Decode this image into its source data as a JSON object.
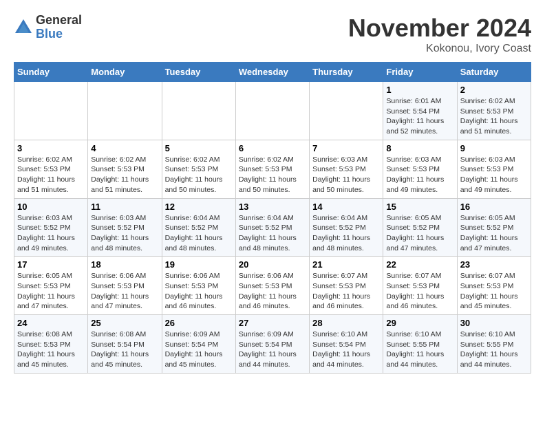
{
  "header": {
    "logo_general": "General",
    "logo_blue": "Blue",
    "month_title": "November 2024",
    "location": "Kokonou, Ivory Coast"
  },
  "days_of_week": [
    "Sunday",
    "Monday",
    "Tuesday",
    "Wednesday",
    "Thursday",
    "Friday",
    "Saturday"
  ],
  "weeks": [
    [
      {
        "day": "",
        "info": ""
      },
      {
        "day": "",
        "info": ""
      },
      {
        "day": "",
        "info": ""
      },
      {
        "day": "",
        "info": ""
      },
      {
        "day": "",
        "info": ""
      },
      {
        "day": "1",
        "info": "Sunrise: 6:01 AM\nSunset: 5:54 PM\nDaylight: 11 hours and 52 minutes."
      },
      {
        "day": "2",
        "info": "Sunrise: 6:02 AM\nSunset: 5:53 PM\nDaylight: 11 hours and 51 minutes."
      }
    ],
    [
      {
        "day": "3",
        "info": "Sunrise: 6:02 AM\nSunset: 5:53 PM\nDaylight: 11 hours and 51 minutes."
      },
      {
        "day": "4",
        "info": "Sunrise: 6:02 AM\nSunset: 5:53 PM\nDaylight: 11 hours and 51 minutes."
      },
      {
        "day": "5",
        "info": "Sunrise: 6:02 AM\nSunset: 5:53 PM\nDaylight: 11 hours and 50 minutes."
      },
      {
        "day": "6",
        "info": "Sunrise: 6:02 AM\nSunset: 5:53 PM\nDaylight: 11 hours and 50 minutes."
      },
      {
        "day": "7",
        "info": "Sunrise: 6:03 AM\nSunset: 5:53 PM\nDaylight: 11 hours and 50 minutes."
      },
      {
        "day": "8",
        "info": "Sunrise: 6:03 AM\nSunset: 5:53 PM\nDaylight: 11 hours and 49 minutes."
      },
      {
        "day": "9",
        "info": "Sunrise: 6:03 AM\nSunset: 5:53 PM\nDaylight: 11 hours and 49 minutes."
      }
    ],
    [
      {
        "day": "10",
        "info": "Sunrise: 6:03 AM\nSunset: 5:52 PM\nDaylight: 11 hours and 49 minutes."
      },
      {
        "day": "11",
        "info": "Sunrise: 6:03 AM\nSunset: 5:52 PM\nDaylight: 11 hours and 48 minutes."
      },
      {
        "day": "12",
        "info": "Sunrise: 6:04 AM\nSunset: 5:52 PM\nDaylight: 11 hours and 48 minutes."
      },
      {
        "day": "13",
        "info": "Sunrise: 6:04 AM\nSunset: 5:52 PM\nDaylight: 11 hours and 48 minutes."
      },
      {
        "day": "14",
        "info": "Sunrise: 6:04 AM\nSunset: 5:52 PM\nDaylight: 11 hours and 48 minutes."
      },
      {
        "day": "15",
        "info": "Sunrise: 6:05 AM\nSunset: 5:52 PM\nDaylight: 11 hours and 47 minutes."
      },
      {
        "day": "16",
        "info": "Sunrise: 6:05 AM\nSunset: 5:52 PM\nDaylight: 11 hours and 47 minutes."
      }
    ],
    [
      {
        "day": "17",
        "info": "Sunrise: 6:05 AM\nSunset: 5:53 PM\nDaylight: 11 hours and 47 minutes."
      },
      {
        "day": "18",
        "info": "Sunrise: 6:06 AM\nSunset: 5:53 PM\nDaylight: 11 hours and 47 minutes."
      },
      {
        "day": "19",
        "info": "Sunrise: 6:06 AM\nSunset: 5:53 PM\nDaylight: 11 hours and 46 minutes."
      },
      {
        "day": "20",
        "info": "Sunrise: 6:06 AM\nSunset: 5:53 PM\nDaylight: 11 hours and 46 minutes."
      },
      {
        "day": "21",
        "info": "Sunrise: 6:07 AM\nSunset: 5:53 PM\nDaylight: 11 hours and 46 minutes."
      },
      {
        "day": "22",
        "info": "Sunrise: 6:07 AM\nSunset: 5:53 PM\nDaylight: 11 hours and 46 minutes."
      },
      {
        "day": "23",
        "info": "Sunrise: 6:07 AM\nSunset: 5:53 PM\nDaylight: 11 hours and 45 minutes."
      }
    ],
    [
      {
        "day": "24",
        "info": "Sunrise: 6:08 AM\nSunset: 5:53 PM\nDaylight: 11 hours and 45 minutes."
      },
      {
        "day": "25",
        "info": "Sunrise: 6:08 AM\nSunset: 5:54 PM\nDaylight: 11 hours and 45 minutes."
      },
      {
        "day": "26",
        "info": "Sunrise: 6:09 AM\nSunset: 5:54 PM\nDaylight: 11 hours and 45 minutes."
      },
      {
        "day": "27",
        "info": "Sunrise: 6:09 AM\nSunset: 5:54 PM\nDaylight: 11 hours and 44 minutes."
      },
      {
        "day": "28",
        "info": "Sunrise: 6:10 AM\nSunset: 5:54 PM\nDaylight: 11 hours and 44 minutes."
      },
      {
        "day": "29",
        "info": "Sunrise: 6:10 AM\nSunset: 5:55 PM\nDaylight: 11 hours and 44 minutes."
      },
      {
        "day": "30",
        "info": "Sunrise: 6:10 AM\nSunset: 5:55 PM\nDaylight: 11 hours and 44 minutes."
      }
    ]
  ]
}
